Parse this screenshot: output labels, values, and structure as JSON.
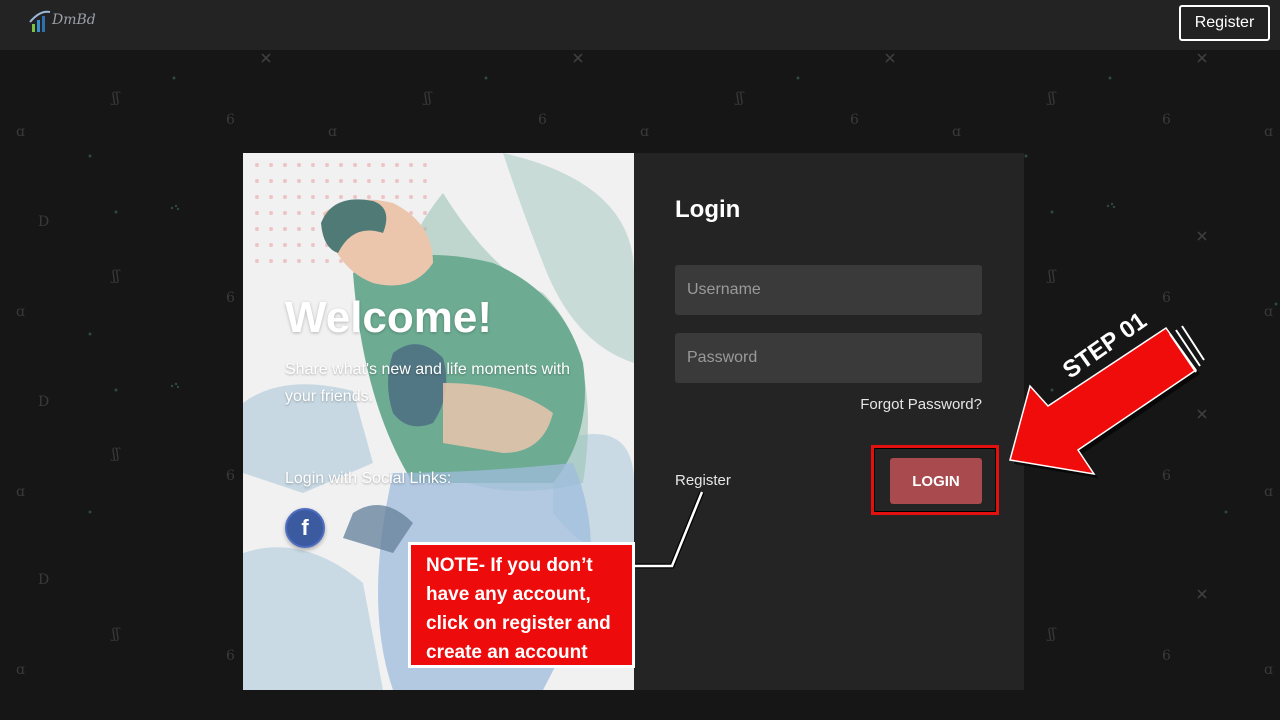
{
  "header": {
    "logo_text": "DmBd",
    "register_button": "Register"
  },
  "welcome_panel": {
    "title": "Welcome!",
    "subtitle": "Share what's new and life moments with your friends.",
    "social_label": "Login with Social Links:",
    "facebook_glyph": "f"
  },
  "login_form": {
    "title": "Login",
    "username_placeholder": "Username",
    "password_placeholder": "Password",
    "forgot_password": "Forgot Password?",
    "register_link": "Register",
    "login_button": "LOGIN"
  },
  "annotations": {
    "step_label": "STEP 01",
    "note": "NOTE- If you don’t have any account, click on register and create an account",
    "highlight_color": "#e31010"
  },
  "colors": {
    "background": "#161616",
    "topbar": "#232323",
    "form_panel": "#242424",
    "login_button": "#a84a4e",
    "facebook": "#3b5aa0",
    "note_box": "#ee0b0b"
  }
}
